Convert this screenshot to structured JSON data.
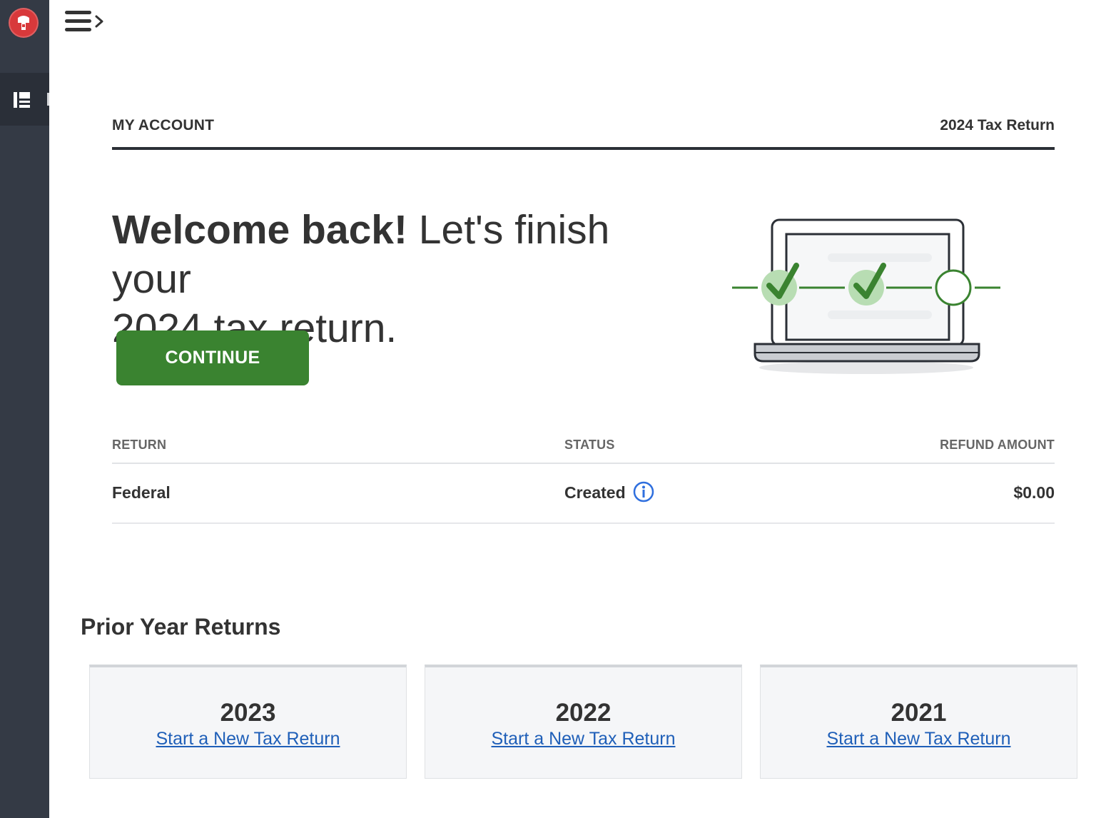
{
  "header": {
    "section_label": "MY ACCOUNT",
    "return_label": "2024 Tax Return"
  },
  "welcome": {
    "bold": "Welcome back!",
    "rest_line1": " Let's finish your",
    "line2": "2024 tax return."
  },
  "actions": {
    "continue_label": "CONTINUE"
  },
  "returns_table": {
    "columns": [
      "RETURN",
      "STATUS",
      "REFUND AMOUNT"
    ],
    "rows": [
      {
        "return": "Federal",
        "status": "Created",
        "refund": "$0.00"
      }
    ]
  },
  "prior_years": {
    "title": "Prior Year Returns",
    "cards": [
      {
        "year": "2023",
        "link": "Start a New Tax Return"
      },
      {
        "year": "2022",
        "link": "Start a New Tax Return"
      },
      {
        "year": "2021",
        "link": "Start a New Tax Return"
      }
    ]
  },
  "icons": {
    "logo": "taxslayer-logo",
    "menu": "hamburger-expand-icon",
    "nav": "dashboard-icon",
    "info": "info-icon"
  },
  "colors": {
    "sidebar": "#343a45",
    "primary_button": "#3a8330",
    "link": "#1f5fb8",
    "info_icon": "#2f6fde",
    "logo": "#d8393b"
  }
}
